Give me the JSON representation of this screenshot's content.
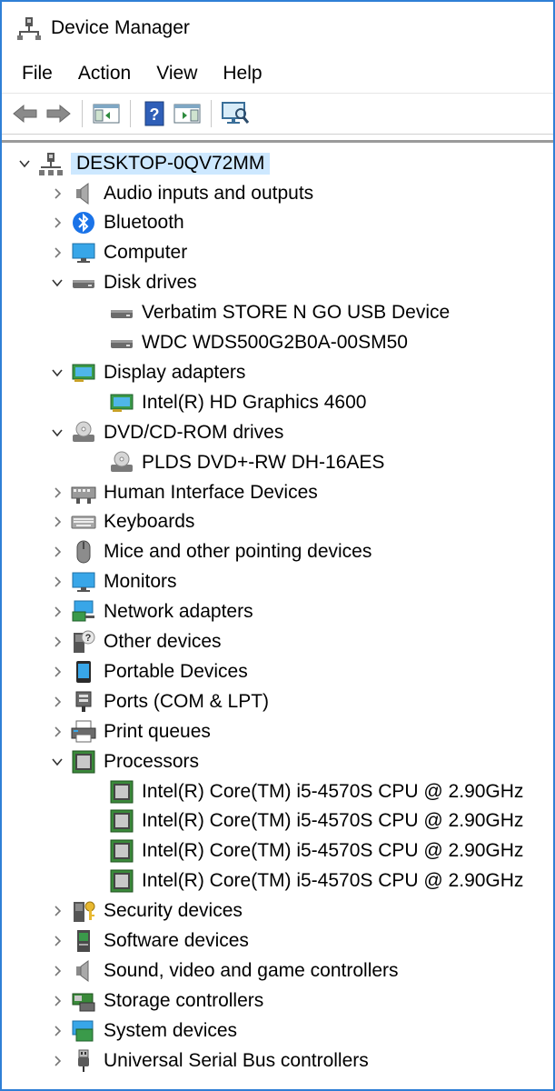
{
  "window": {
    "title": "Device Manager"
  },
  "menu": [
    "File",
    "Action",
    "View",
    "Help"
  ],
  "toolbar": [
    "back",
    "forward",
    "show-hide-console-tree",
    "help",
    "properties",
    "scan-for-hardware-changes"
  ],
  "tree": {
    "root": {
      "label": "DESKTOP-0QV72MM",
      "expanded": true
    },
    "nodes": [
      {
        "label": "Audio inputs and outputs",
        "level": 1,
        "expanded": false,
        "icon": "speaker-icon"
      },
      {
        "label": "Bluetooth",
        "level": 1,
        "expanded": false,
        "icon": "bluetooth-icon"
      },
      {
        "label": "Computer",
        "level": 1,
        "expanded": false,
        "icon": "computer-icon"
      },
      {
        "label": "Disk drives",
        "level": 1,
        "expanded": true,
        "icon": "disk-drive-icon"
      },
      {
        "label": "Verbatim STORE N GO USB Device",
        "level": 2,
        "icon": "disk-drive-icon"
      },
      {
        "label": "WDC WDS500G2B0A-00SM50",
        "level": 2,
        "icon": "disk-drive-icon"
      },
      {
        "label": "Display adapters",
        "level": 1,
        "expanded": true,
        "icon": "display-adapter-icon"
      },
      {
        "label": "Intel(R) HD Graphics 4600",
        "level": 2,
        "icon": "display-adapter-icon"
      },
      {
        "label": "DVD/CD-ROM drives",
        "level": 1,
        "expanded": true,
        "icon": "optical-drive-icon"
      },
      {
        "label": "PLDS DVD+-RW DH-16AES",
        "level": 2,
        "icon": "optical-drive-icon"
      },
      {
        "label": "Human Interface Devices",
        "level": 1,
        "expanded": false,
        "icon": "hid-icon"
      },
      {
        "label": "Keyboards",
        "level": 1,
        "expanded": false,
        "icon": "keyboard-icon"
      },
      {
        "label": "Mice and other pointing devices",
        "level": 1,
        "expanded": false,
        "icon": "mouse-icon"
      },
      {
        "label": "Monitors",
        "level": 1,
        "expanded": false,
        "icon": "monitor-icon"
      },
      {
        "label": "Network adapters",
        "level": 1,
        "expanded": false,
        "icon": "network-icon"
      },
      {
        "label": "Other devices",
        "level": 1,
        "expanded": false,
        "icon": "other-device-icon"
      },
      {
        "label": "Portable Devices",
        "level": 1,
        "expanded": false,
        "icon": "portable-device-icon"
      },
      {
        "label": "Ports (COM & LPT)",
        "level": 1,
        "expanded": false,
        "icon": "port-icon"
      },
      {
        "label": "Print queues",
        "level": 1,
        "expanded": false,
        "icon": "printer-icon"
      },
      {
        "label": "Processors",
        "level": 1,
        "expanded": true,
        "icon": "processor-icon"
      },
      {
        "label": "Intel(R) Core(TM) i5-4570S CPU @ 2.90GHz",
        "level": 2,
        "icon": "processor-icon"
      },
      {
        "label": "Intel(R) Core(TM) i5-4570S CPU @ 2.90GHz",
        "level": 2,
        "icon": "processor-icon"
      },
      {
        "label": "Intel(R) Core(TM) i5-4570S CPU @ 2.90GHz",
        "level": 2,
        "icon": "processor-icon"
      },
      {
        "label": "Intel(R) Core(TM) i5-4570S CPU @ 2.90GHz",
        "level": 2,
        "icon": "processor-icon"
      },
      {
        "label": "Security devices",
        "level": 1,
        "expanded": false,
        "icon": "security-device-icon"
      },
      {
        "label": "Software devices",
        "level": 1,
        "expanded": false,
        "icon": "software-device-icon"
      },
      {
        "label": "Sound, video and game controllers",
        "level": 1,
        "expanded": false,
        "icon": "speaker-icon"
      },
      {
        "label": "Storage controllers",
        "level": 1,
        "expanded": false,
        "icon": "storage-controller-icon"
      },
      {
        "label": "System devices",
        "level": 1,
        "expanded": false,
        "icon": "system-device-icon"
      },
      {
        "label": "Universal Serial Bus controllers",
        "level": 1,
        "expanded": false,
        "icon": "usb-icon"
      }
    ]
  },
  "colors": {
    "window_border": "#2f7fd6",
    "selection": "#cde8ff"
  }
}
